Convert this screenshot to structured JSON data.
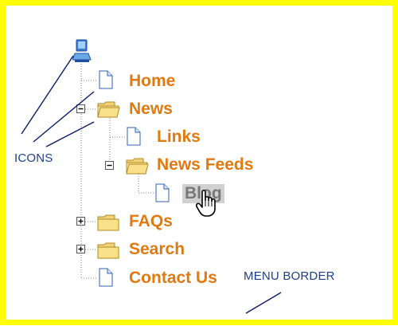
{
  "tree": {
    "root_icon": "computer-icon",
    "items": [
      {
        "label": "Home",
        "icon": "page-icon",
        "toggle": ""
      },
      {
        "label": "News",
        "icon": "folder-open-icon",
        "toggle": "minus"
      },
      {
        "label": "Links",
        "icon": "page-icon",
        "toggle": ""
      },
      {
        "label": "News Feeds",
        "icon": "folder-open-icon",
        "toggle": "minus"
      },
      {
        "label": "Blog",
        "icon": "page-icon",
        "toggle": "",
        "selected": true
      },
      {
        "label": "FAQs",
        "icon": "folder-icon",
        "toggle": "plus"
      },
      {
        "label": "Search",
        "icon": "folder-icon",
        "toggle": "plus"
      },
      {
        "label": "Contact Us",
        "icon": "page-icon",
        "toggle": ""
      }
    ]
  },
  "annotations": {
    "icons": "ICONS",
    "menu_border": "MENU BORDER"
  },
  "colors": {
    "border": "#ffff00",
    "label": "#e07a10",
    "selected_bg": "#d0d0d0",
    "selected_text": "#777777",
    "annotation": "#1c3f8c"
  },
  "cursor_icon": "hand-pointer-icon"
}
